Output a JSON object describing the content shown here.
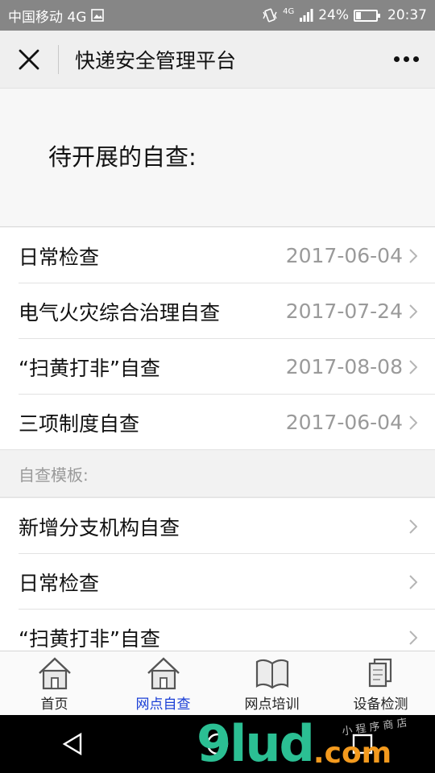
{
  "status_bar": {
    "carrier": "中国移动 4G",
    "net_small": "4G",
    "battery": "24%",
    "battery_level": 0.24,
    "time": "20:37"
  },
  "nav": {
    "title": "快递安全管理平台"
  },
  "hero": {
    "title": "待开展的自查:"
  },
  "pending_items": [
    {
      "label": "日常检查",
      "date": "2017-06-04"
    },
    {
      "label": "电气火灾综合治理自查",
      "date": "2017-07-24"
    },
    {
      "label": "“扫黄打非”自查",
      "date": "2017-08-08"
    },
    {
      "label": "三项制度自查",
      "date": "2017-06-04"
    }
  ],
  "templates": {
    "label": "自查模板:",
    "items": [
      {
        "label": "新增分支机构自查"
      },
      {
        "label": "日常检查"
      },
      {
        "label": "“扫黄打非”自查"
      }
    ]
  },
  "tabs": [
    {
      "label": "首页",
      "icon": "home-icon"
    },
    {
      "label": "网点自查",
      "icon": "home-icon",
      "active": true
    },
    {
      "label": "网点培训",
      "icon": "book-icon"
    },
    {
      "label": "设备检测",
      "icon": "copy-icon"
    }
  ],
  "watermark": {
    "main": "9lud",
    "dot": ".com",
    "small": "小 程 序 商 店"
  },
  "colors": {
    "status_bar": "#868686",
    "nav_bg": "#efefef",
    "active_tab": "#1a3fd6",
    "date_text": "#9a9a9a"
  }
}
